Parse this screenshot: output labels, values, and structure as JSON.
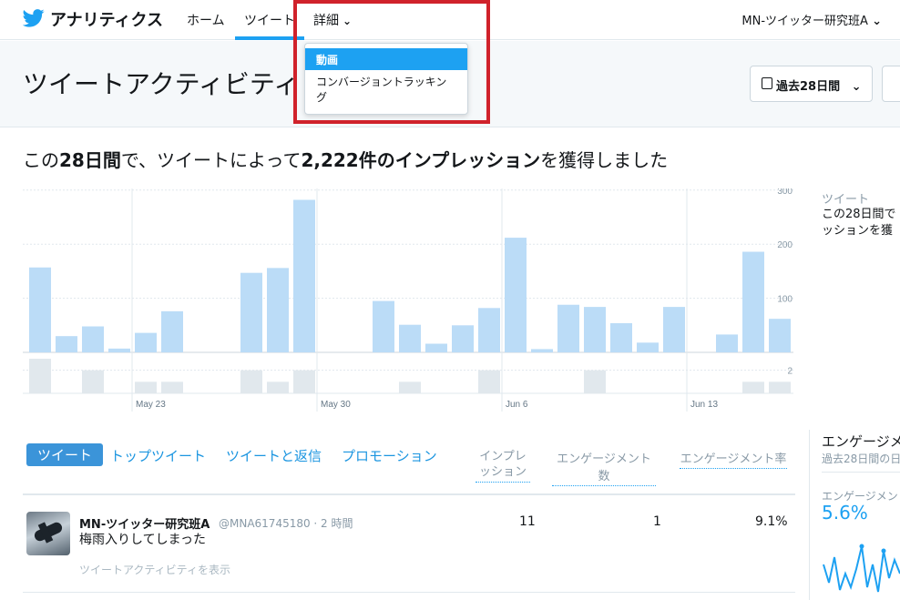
{
  "nav": {
    "app_title": "アナリティクス",
    "home": "ホーム",
    "tweets": "ツイート",
    "more": "詳細",
    "account": "MN-ツイッター研究班A"
  },
  "dropdown": {
    "items": [
      "動画",
      "コンバージョントラッキン",
      "グ"
    ]
  },
  "header": {
    "title": "ツイートアクティビティ",
    "range_label": "過去28日間"
  },
  "summary": {
    "prefix": "この",
    "period": "28日間",
    "middle": "で、ツイートによって",
    "count": "2,222件のインプレッション",
    "suffix": "を獲得しました"
  },
  "side": {
    "label": "ツイート",
    "desc_line1": "この28日間で",
    "desc_line2": "ッションを獲"
  },
  "chart_data": {
    "type": "bar",
    "x_labels": [
      "May 23",
      "May 30",
      "Jun 6",
      "Jun 13"
    ],
    "y_ticks": [
      100,
      200,
      300
    ],
    "ylim": [
      0,
      300
    ],
    "impressions": [
      157,
      30,
      48,
      7,
      36,
      76,
      0,
      0,
      147,
      156,
      282,
      0,
      0,
      95,
      51,
      16,
      50,
      82,
      212,
      6,
      88,
      84,
      54,
      18,
      84,
      0,
      33,
      186,
      62
    ],
    "engagements": [
      3,
      0,
      2,
      0,
      1,
      1,
      0,
      0,
      2,
      1,
      2,
      0,
      0,
      0,
      1,
      0,
      0,
      2,
      0,
      0,
      0,
      2,
      0,
      0,
      0,
      0,
      0,
      1,
      1
    ],
    "eng_tick": 2
  },
  "tabs": [
    "ツイート",
    "トップツイート",
    "ツイートと返信",
    "プロモーション"
  ],
  "columns": {
    "impressions_l1": "インプレ",
    "impressions_l2": "ッション",
    "engagements": "エンゲージメント数",
    "rate": "エンゲージメント率"
  },
  "tweet": {
    "name": "MN-ツイッター研究班A",
    "handle": "@MNA61745180 · 2 時間",
    "text": "梅雨入りしてしまった",
    "activity_link": "ツイートアクティビティを表示",
    "impressions": "11",
    "engagements": "1",
    "rate": "9.1%"
  },
  "engagement_panel": {
    "title": "エンゲージメ",
    "subtitle": "過去28日間の日",
    "rate_label": "エンゲージメン",
    "rate_value": "5.6%"
  },
  "colors": {
    "accent": "#1da1f2",
    "bar": "#bbdcf7",
    "eng_bar": "#e1e8ed",
    "highlight": "#d0222b"
  }
}
